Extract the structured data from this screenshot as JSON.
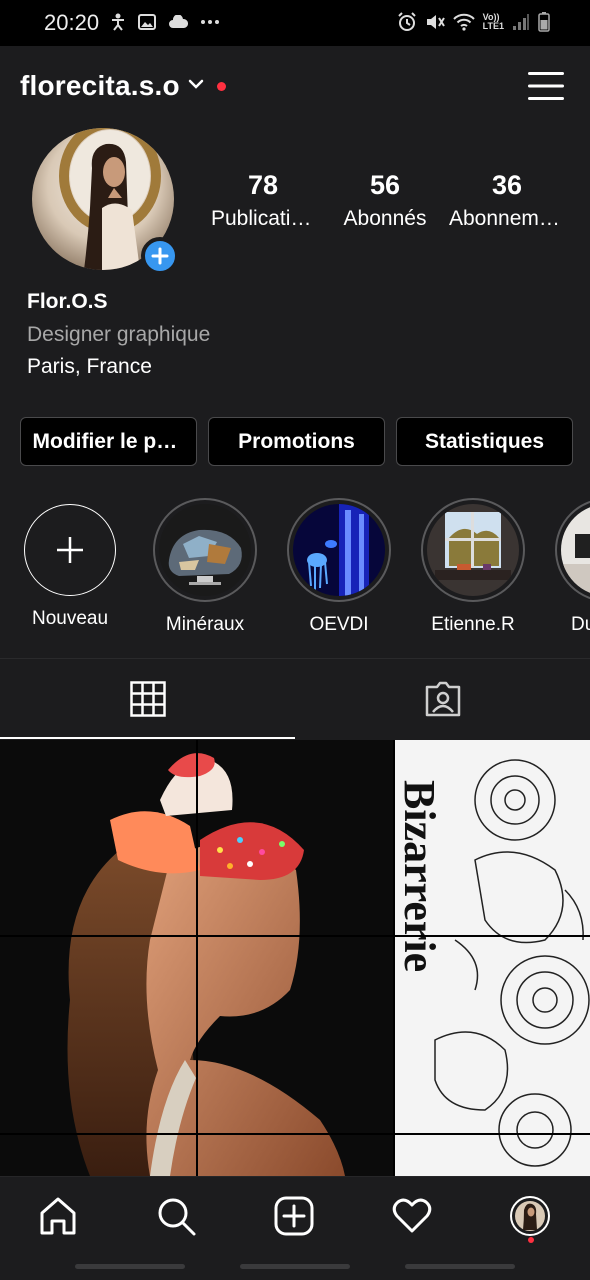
{
  "status_bar": {
    "time": "20:20",
    "left_icons": [
      "accessibility-icon",
      "image-icon",
      "cloud-icon",
      "more-dots-icon"
    ],
    "right_icons": [
      "alarm-icon",
      "mute-icon",
      "wifi-icon",
      "volte-icon",
      "signal-icon",
      "battery-icon"
    ],
    "network_label_top": "Vo))",
    "network_label_bottom": "LTE1"
  },
  "profile": {
    "username": "florecita.s.o",
    "has_notification_dot": true,
    "stats": [
      {
        "value": "78",
        "label": "Publications"
      },
      {
        "value": "56",
        "label": "Abonnés"
      },
      {
        "value": "36",
        "label": "Abonnements"
      }
    ],
    "display_name": "Flor.O.S",
    "category": "Designer graphique",
    "location": "Paris, France"
  },
  "buttons": {
    "edit": "Modifier le profil",
    "promotions": "Promotions",
    "insights": "Statistiques"
  },
  "highlights": [
    {
      "label": "Nouveau"
    },
    {
      "label": "Minéraux"
    },
    {
      "label": "OEVDI"
    },
    {
      "label": "Etienne.R"
    },
    {
      "label": "Du"
    }
  ],
  "post_text": "Bizarrerie",
  "colors": {
    "background": "#1c1c1e",
    "accent_blue": "#3797f0",
    "notification_red": "#ff3040",
    "secondary_text": "#a8a8a8"
  }
}
